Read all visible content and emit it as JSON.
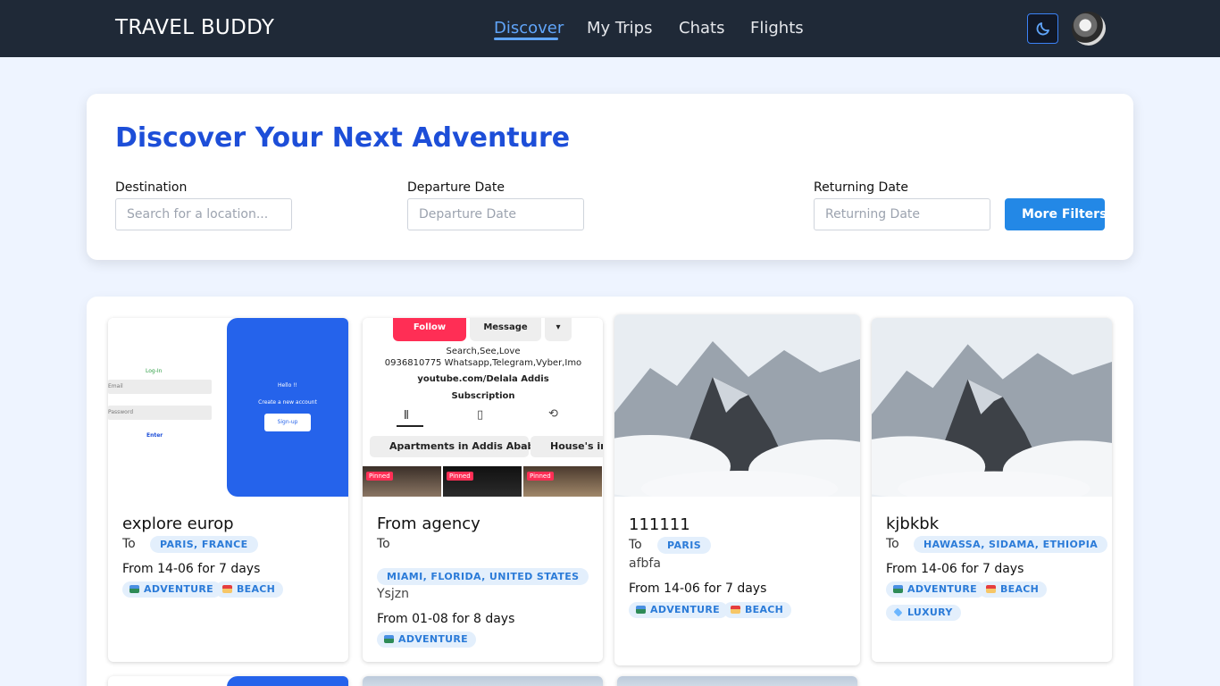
{
  "navbar": {
    "brand": "TRAVEL BUDDY",
    "links": [
      "Discover",
      "My Trips",
      "Chats",
      "Flights"
    ],
    "active_link": "Discover",
    "theme_icon": "moon-icon"
  },
  "search": {
    "title": "Discover Your Next Adventure",
    "destination_label": "Destination",
    "destination_placeholder": "Search for a location...",
    "departure_label": "Departure Date",
    "departure_placeholder": "Departure Date",
    "returning_label": "Returning Date",
    "returning_placeholder": "Returning Date",
    "more_filters": "More Filters"
  },
  "cards": [
    {
      "title": "explore europ",
      "to": "To",
      "location": "PARIS, FRANCE",
      "description": "",
      "dates": "From 14-06 for 7 days",
      "tags": [
        "ADVENTURE",
        "BEACH"
      ]
    },
    {
      "title": "From agency",
      "to": "To",
      "location": "MIAMI, FLORIDA, UNITED STATES",
      "description": "Ysjzn",
      "dates": "From 01-08 for 8 days",
      "tags": [
        "ADVENTURE"
      ]
    },
    {
      "title": "111111",
      "to": "To",
      "location": "PARIS",
      "description": "afbfa",
      "dates": "From 14-06 for 7 days",
      "tags": [
        "ADVENTURE",
        "BEACH"
      ]
    },
    {
      "title": "kjbkbk",
      "to": "To",
      "location": "HAWASSA, SIDAMA, ETHIOPIA",
      "description": "",
      "dates": "From 14-06 for 7 days",
      "tags": [
        "ADVENTURE",
        "BEACH",
        "LUXURY"
      ]
    }
  ],
  "card_images": {
    "login": {
      "login_label": "Log-In",
      "email_hint": "Email",
      "password_hint": "Password",
      "enter": "Enter",
      "hello": "Hello !!",
      "create": "Create a new account",
      "signup": "Sign-up"
    },
    "insta": {
      "follow": "Follow",
      "message": "Message",
      "bio1": "Search,See,Love",
      "bio2": "0936810775 Whatsapp,Telegram,Vyber,Imo",
      "bio3": "youtube.com/Delala Addis",
      "bio4": "Subscription",
      "chip1": "Apartments in Addis Ababa",
      "chip2": "House's in A",
      "pinned": "Pinned"
    }
  }
}
